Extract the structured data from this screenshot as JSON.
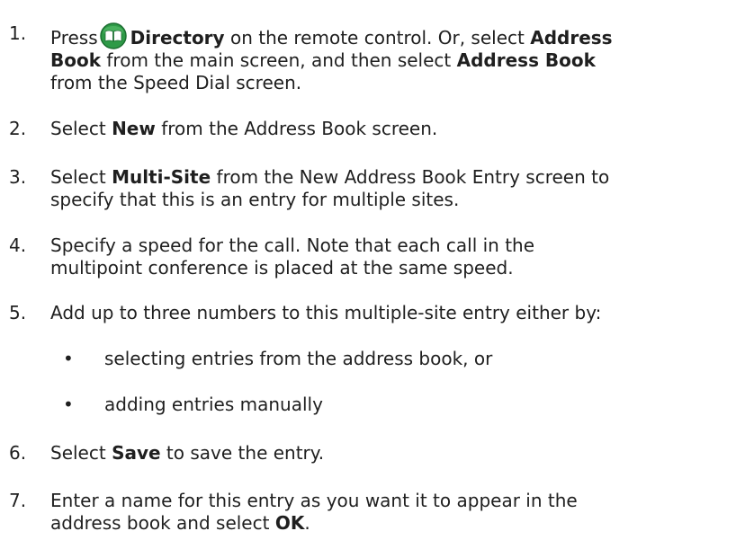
{
  "steps": [
    {
      "number": "1.",
      "parts": {
        "p1": "Press",
        "icon": "directory-book-icon",
        "b1": "Directory",
        "p2": " on the remote control. Or, select ",
        "b2": "Address",
        "b3": "Book",
        "p3": " from the main screen, and then select ",
        "b4": "Address Book",
        "p4": "from the Speed Dial screen."
      }
    },
    {
      "number": "2.",
      "parts": {
        "p1": "Select ",
        "b1": "New",
        "p2": " from the Address Book screen."
      }
    },
    {
      "number": "3.",
      "parts": {
        "p1": "Select ",
        "b1": "Multi-Site",
        "p2": " from the New Address Book Entry screen to",
        "p3": "specify that this is an entry for multiple sites."
      }
    },
    {
      "number": "4.",
      "parts": {
        "p1": "Specify a speed for the call. Note that each call in the",
        "p2": "multipoint conference is placed at the same speed."
      }
    },
    {
      "number": "5.",
      "parts": {
        "p1": "Add up to three numbers to this multiple-site entry either by:"
      },
      "bullets": [
        "selecting entries from the address book, or",
        "adding entries manually"
      ]
    },
    {
      "number": "6.",
      "parts": {
        "p1": "Select ",
        "b1": "Save",
        "p2": " to save the entry."
      }
    },
    {
      "number": "7.",
      "parts": {
        "p1": "Enter a name for this entry as you want it to appear in the",
        "p2": "address book and select ",
        "b1": "OK",
        "p3": "."
      }
    }
  ],
  "bullet_symbol": "•",
  "colors": {
    "text": "#1f1f1f",
    "icon_green": "#2e9a47",
    "icon_dark_green": "#1c6e31",
    "icon_book": "#ffffff"
  }
}
